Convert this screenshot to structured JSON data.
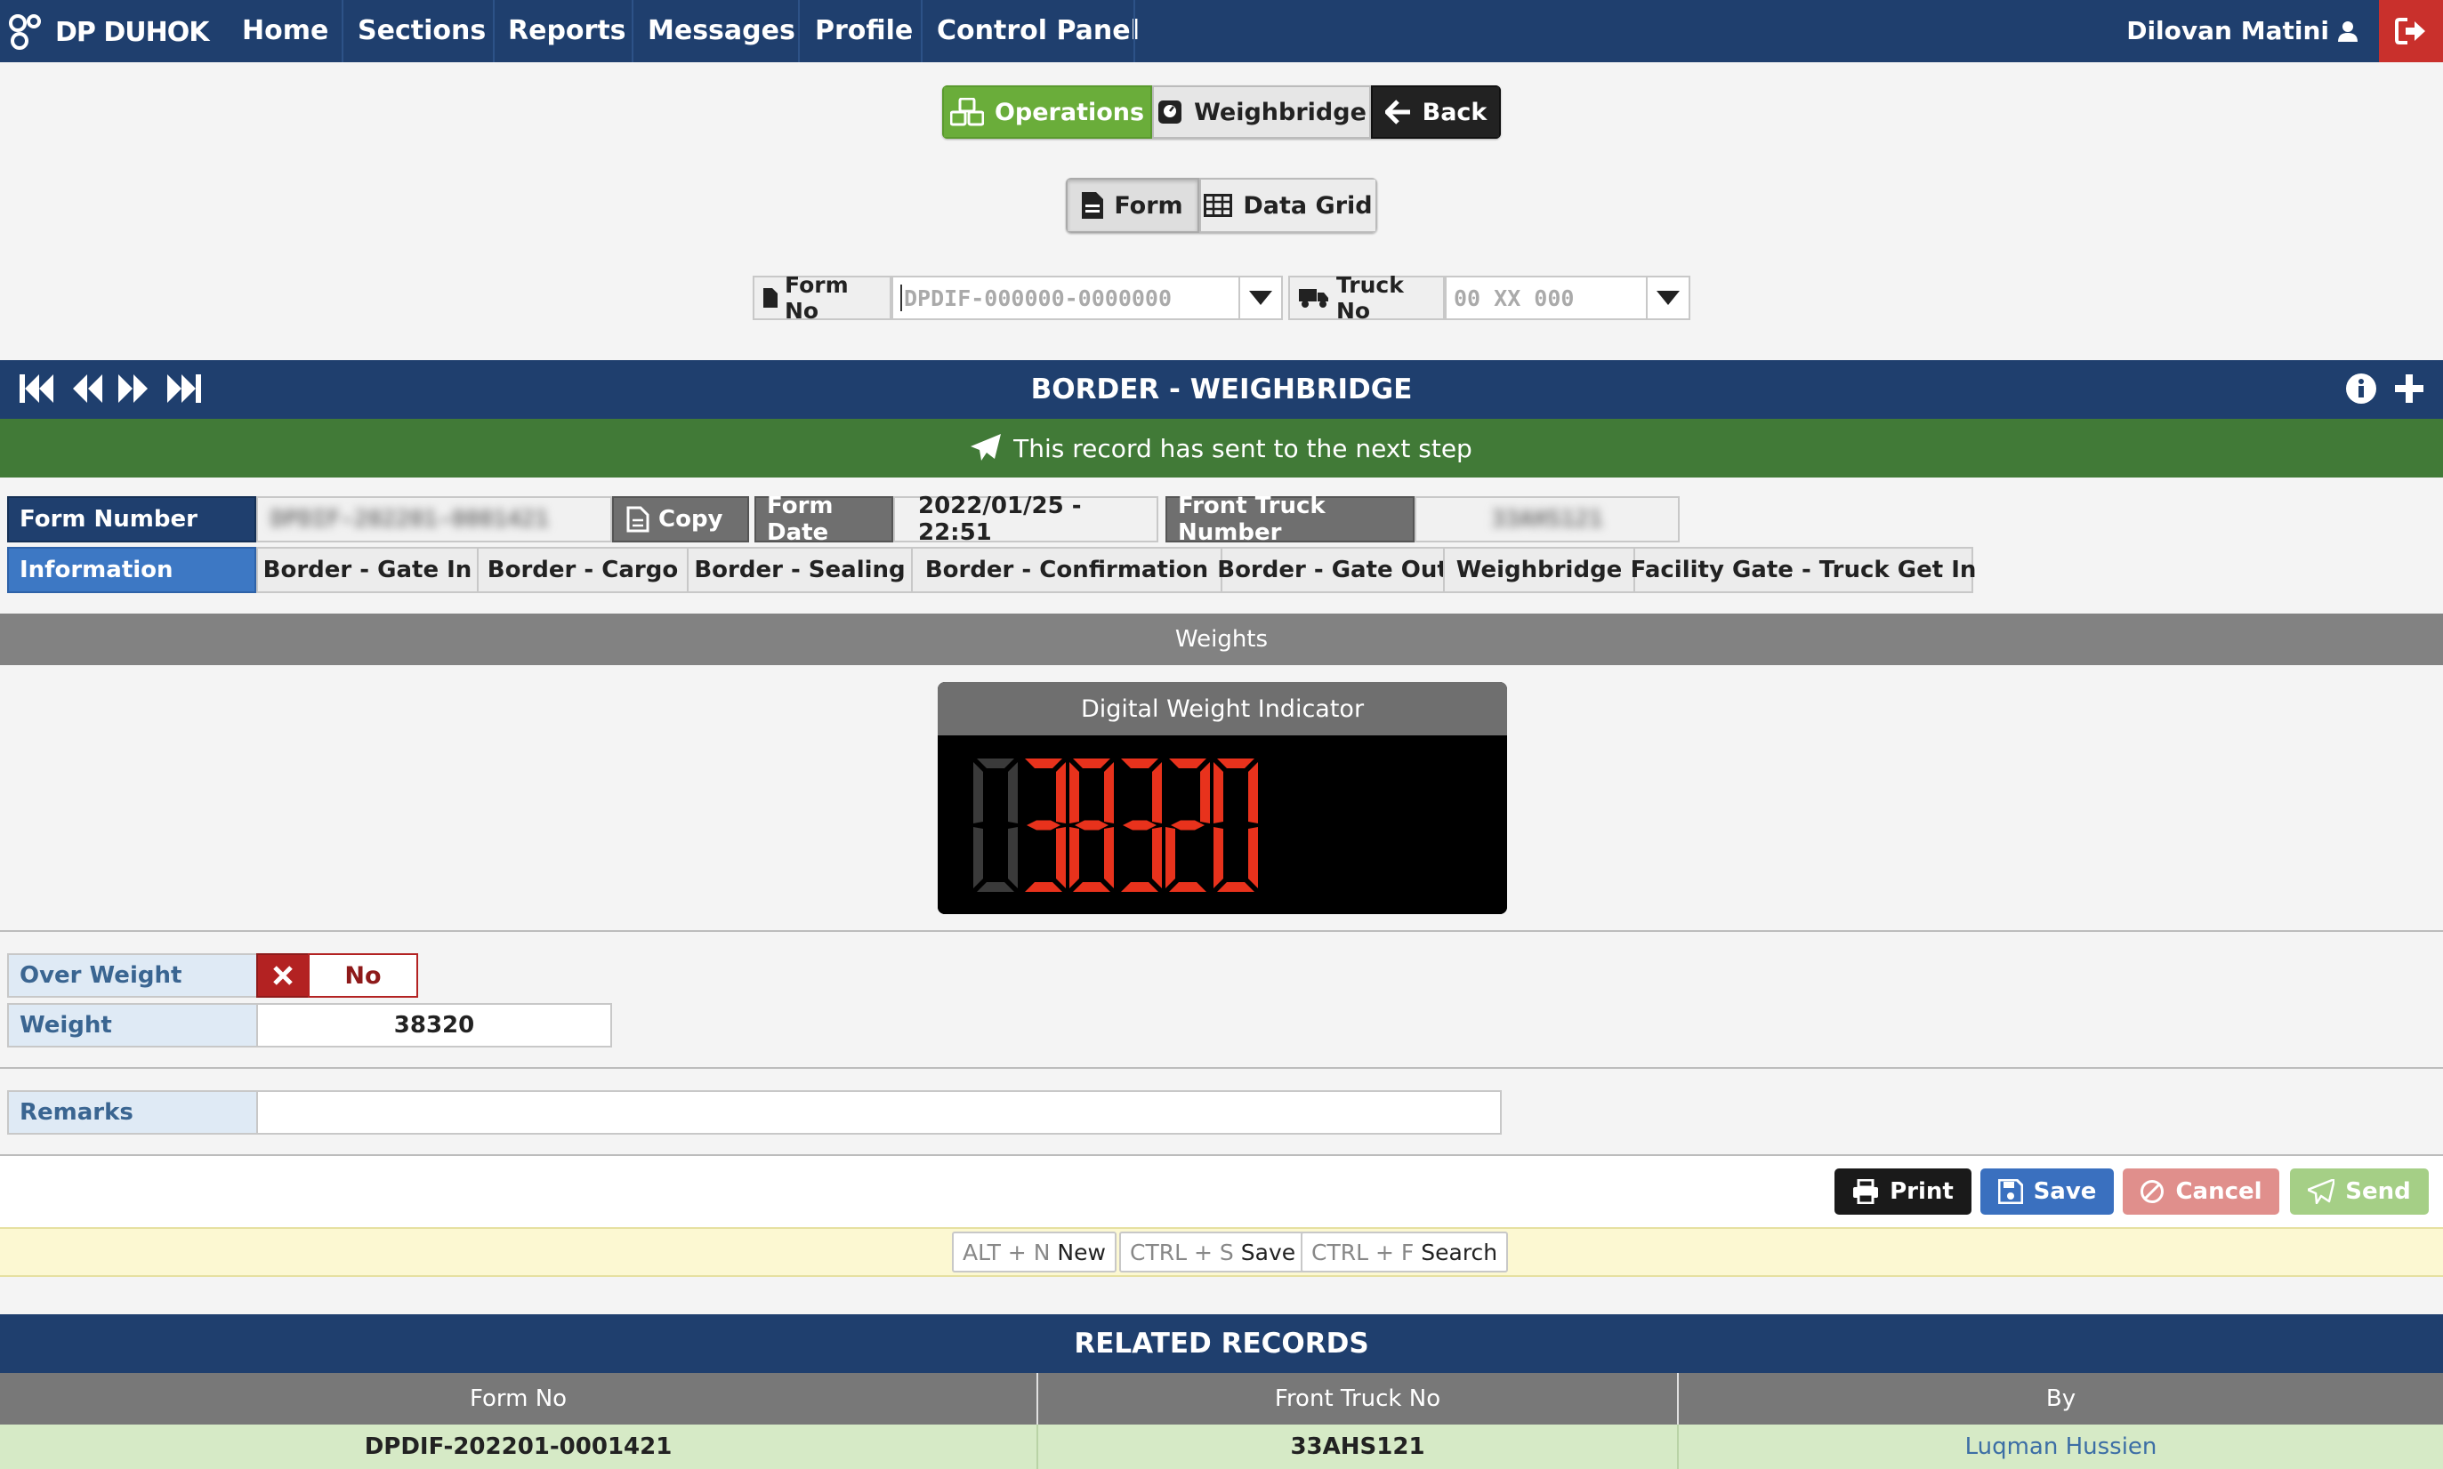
{
  "nav": {
    "brand": "DP DUHOK",
    "links": [
      "Home",
      "Sections",
      "Reports",
      "Messages",
      "Profile",
      "Control Panel"
    ],
    "user": "Dilovan Matini"
  },
  "modules": {
    "operations": "Operations",
    "weighbridge": "Weighbridge",
    "back": "Back"
  },
  "views": {
    "form": "Form",
    "data_grid": "Data Grid"
  },
  "search": {
    "form_no_label": "Form No",
    "form_no_placeholder": "DPDIF-000000-0000000",
    "truck_no_label": "Truck No",
    "truck_no_placeholder": "00 XX 000"
  },
  "panel": {
    "title": "BORDER - WEIGHBRIDGE",
    "status_message": "This record has sent to the next step"
  },
  "record": {
    "form_number_label": "Form Number",
    "form_number_value": "DPDIF-202201-0001421",
    "copy_label": "Copy",
    "form_date_label": "Form Date",
    "form_date_value": "2022/01/25 - 22:51",
    "front_truck_label": "Front Truck Number",
    "front_truck_value": "33AHS121"
  },
  "tabs": {
    "active": "Information",
    "items": [
      "Border - Gate In",
      "Border - Cargo",
      "Border - Sealing",
      "Border - Confirmation",
      "Border - Gate Out",
      "Weighbridge",
      "Facility Gate - Truck Get In"
    ]
  },
  "weights": {
    "section_title": "Weights",
    "indicator_title": "Digital Weight Indicator",
    "indicator_digits": "038320",
    "over_weight_label": "Over Weight",
    "over_weight_value": "No",
    "weight_label": "Weight",
    "weight_value": "38320",
    "remarks_label": "Remarks",
    "remarks_value": ""
  },
  "actions": {
    "print": "Print",
    "save": "Save",
    "cancel": "Cancel",
    "send": "Send"
  },
  "shortcuts": [
    {
      "key": "ALT + N",
      "action": "New"
    },
    {
      "key": "CTRL + S",
      "action": "Save"
    },
    {
      "key": "CTRL + F",
      "action": "Search"
    }
  ],
  "related": {
    "title": "RELATED RECORDS",
    "columns": [
      "Form No",
      "Front Truck No",
      "By"
    ],
    "rows": [
      {
        "form_no": "DPDIF-202201-0001421",
        "truck_no": "33AHS121",
        "by": "Luqman Hussien"
      }
    ]
  },
  "colors": {
    "navy": "#1f3f6e",
    "green_status": "#417a37",
    "operations_green": "#6aad3a",
    "info_blue": "#3d78c4",
    "danger": "#b32222",
    "digit_on": "#e8321c",
    "digit_off": "#3a3a3a"
  }
}
